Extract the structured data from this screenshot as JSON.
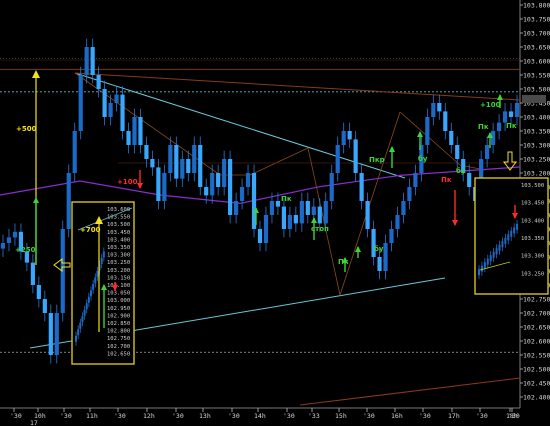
{
  "chart_data": {
    "type": "candlestick",
    "title": "",
    "y_axis": {
      "range": [
        103.35,
        103.815
      ],
      "ticks": [
        "103.800",
        "103.750",
        "103.700",
        "103.650",
        "103.600",
        "103.550",
        "103.500",
        "103.450",
        "103.400",
        "103.350",
        "103.300",
        "103.250",
        "103.200",
        "103.150",
        "103.100",
        "103.050",
        "103.000",
        "102.950",
        "102.900",
        "102.850",
        "102.800",
        "102.750",
        "102.700",
        "102.650",
        "102.600",
        "102.550",
        "102.500",
        "102.450",
        "102.400"
      ]
    },
    "x_axis": {
      "ticks": [
        "'30",
        "10h",
        "'30",
        "11h",
        "'30",
        "12h",
        "'30",
        "13h",
        "'30",
        "14h",
        "'30",
        "'33",
        "15h",
        "'30",
        "16h",
        "'30",
        "17h",
        "'30",
        "18h",
        "'30"
      ],
      "date_label": "17"
    },
    "series": [
      {
        "values": [
          102.95,
          102.97,
          102.99,
          102.92,
          102.88,
          102.8,
          102.75,
          102.7,
          102.55,
          102.7,
          103.0,
          103.2,
          103.35,
          103.55,
          103.65,
          103.55,
          103.5,
          103.4,
          103.45,
          103.48,
          103.35,
          103.3,
          103.4,
          103.3,
          103.25,
          103.22,
          103.1,
          103.2,
          103.3,
          103.18,
          103.25,
          103.2,
          103.3,
          103.15,
          103.12,
          103.2,
          103.15,
          103.25,
          103.05,
          103.1,
          103.15,
          103.2,
          103.0,
          102.95,
          103.05,
          103.1,
          103.08,
          103.0,
          103.05,
          103.02,
          103.1,
          103.05,
          103.08,
          103.02,
          103.1,
          103.2,
          103.3,
          103.35,
          103.32,
          103.2,
          103.1,
          103.0,
          102.9,
          102.85,
          102.95,
          103.0,
          103.05,
          103.1,
          103.15,
          103.2,
          103.3,
          103.4,
          103.45,
          103.42,
          103.35,
          103.3,
          103.25,
          103.2,
          103.15,
          103.1,
          103.25,
          103.3,
          103.35,
          103.38,
          103.42,
          103.4,
          103.45
        ]
      }
    ],
    "levels": [
      103.57,
      103.49,
      103.49,
      102.56
    ],
    "moving_average": [
      103.05,
      103.1,
      103.05,
      103.02,
      103.08,
      103.12,
      103.15
    ],
    "annotations": [
      "+500",
      "+250",
      "+700",
      "+100",
      "+100",
      "Пк",
      "Пк",
      "стоп",
      "бу",
      "Пк",
      "Пкр",
      "бу",
      "Пк",
      "бу",
      "Пк"
    ],
    "insets": [
      {
        "ticks": [
          "103.600",
          "103.550",
          "103.500",
          "103.450",
          "103.400",
          "103.350",
          "103.300",
          "103.250",
          "103.200",
          "103.150",
          "103.100",
          "103.050",
          "103.000",
          "102.950",
          "102.900",
          "102.850",
          "102.800",
          "102.750",
          "102.700",
          "102.650"
        ]
      },
      {
        "ticks": [
          "103.500",
          "103.450",
          "103.400",
          "103.350",
          "103.300",
          "103.250"
        ]
      }
    ],
    "colors": {
      "background": "#000000",
      "candle_up": "#1c6ac8",
      "candle_down": "#3aa7ff",
      "grid": "#1f1f1f",
      "level_line": "#5cb8c9",
      "trend_line": "#6cc7d8",
      "ma_line": "#8b2cd0",
      "inset_border": "#e6d21a",
      "annotation_yellow": "#f3e21c",
      "annotation_green": "#3fd23a",
      "annotation_red": "#ff2a2a",
      "triangle_line": "#8a4a1a"
    }
  }
}
